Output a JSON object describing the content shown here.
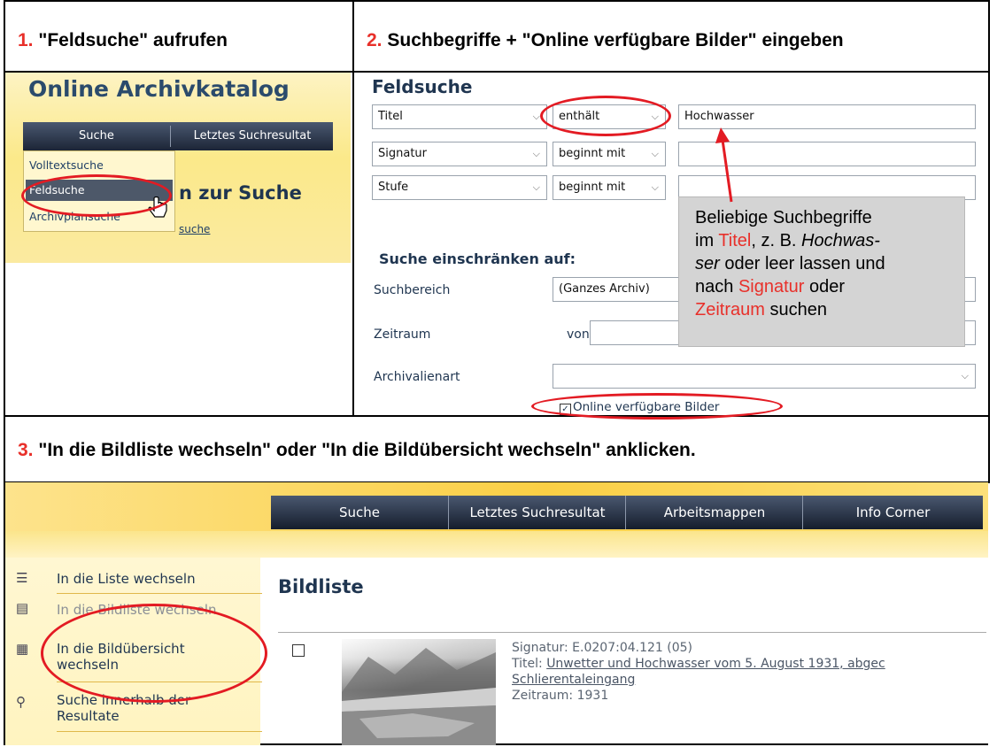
{
  "step1": {
    "num": "1.",
    "title": "\"Feldsuche\" aufrufen"
  },
  "step2": {
    "num": "2.",
    "title": "Suchbegriffe + \"Online verfügbare Bilder\" eingeben"
  },
  "step3": {
    "num": "3.",
    "title": "\"In die Bildliste wechseln\" oder \"In die Bildübersicht wechseln\" anklicken."
  },
  "panel1": {
    "app_title": "Online Archivkatalog",
    "menu": [
      "Suche",
      "Letztes Suchresultat"
    ],
    "dropdown": [
      "Volltextsuche",
      "Feldsuche",
      "Archivplansuche"
    ],
    "heading_fragment": "n zur Suche",
    "link_fragment": "suche"
  },
  "panel2": {
    "title": "Feldsuche",
    "rows": [
      {
        "field": "Titel",
        "op": "enthält",
        "value": "Hochwasser"
      },
      {
        "field": "Signatur",
        "op": "beginnt mit",
        "value": ""
      },
      {
        "field": "Stufe",
        "op": "beginnt mit",
        "value": ""
      }
    ],
    "restrict_heading": "Suche einschränken auf:",
    "suchbereich_label": "Suchbereich",
    "suchbereich_value": "(Ganzes Archiv)",
    "zeitraum_label": "Zeitraum",
    "von_label": "von",
    "archivalienart_label": "Archivalienart",
    "online_checkbox_label": "Online verfügbare Bilder",
    "tooltip": {
      "t1": "Beliebige Suchbegriffe",
      "t2a": "im ",
      "t2b": "Titel",
      "t2c": ", z. B. ",
      "t2d": "Hochwas-",
      "t3a": "ser",
      "t3b": " oder leer lassen und",
      "t4a": "nach ",
      "t4b": "Signatur",
      "t4c": " oder",
      "t5a": "Zeitraum",
      "t5b": " suchen"
    }
  },
  "panel3": {
    "nav": [
      "Suche",
      "Letztes Suchresultat",
      "Arbeitsmappen",
      "Info Corner"
    ],
    "sidebar": [
      "In die Liste wechseln",
      "In die Bildliste wechseln",
      "In die Bildübersicht",
      "wechseln",
      "Suche innerhalb der",
      "Resultate"
    ],
    "heading": "Bildliste",
    "record": {
      "signatur_label": "Signatur:",
      "signatur": "E.0207:04.121 (05)",
      "titel_label": "Titel:",
      "titel_line1": "Unwetter und Hochwasser vom 5. August 1931, abgec",
      "titel_line2": "Schlierentaleingang",
      "zeitraum_label": "Zeitraum:",
      "zeitraum": "1931"
    }
  },
  "colors": {
    "accent_red": "#e8302a",
    "ellipse_red": "#e31b23",
    "nav_dark": "#1c2536"
  }
}
